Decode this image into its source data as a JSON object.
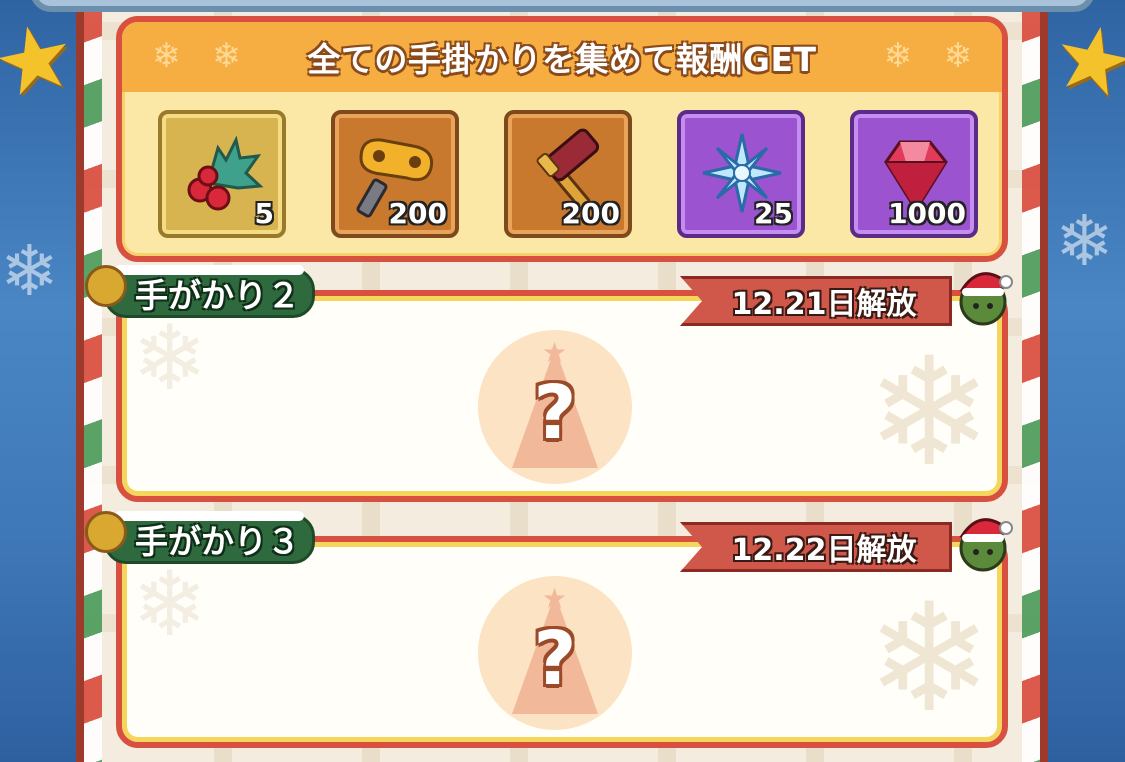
{
  "reward_panel": {
    "title": "全ての手掛かりを集めて報酬GET",
    "items": [
      {
        "icon": "holly-icon",
        "count": "5"
      },
      {
        "icon": "wind-up-key-icon",
        "count": "200"
      },
      {
        "icon": "hammer-icon",
        "count": "200"
      },
      {
        "icon": "snowflake-crystal-icon",
        "count": "25"
      },
      {
        "icon": "ruby-gem-icon",
        "count": "1000"
      }
    ]
  },
  "clues": [
    {
      "label": "手がかり２",
      "unlock": "12.21日解放",
      "locked_symbol": "?"
    },
    {
      "label": "手がかり３",
      "unlock": "12.22日解放",
      "locked_symbol": "?"
    }
  ],
  "colors": {
    "frame_red": "#d8503f",
    "header_orange": "#f6ae42",
    "card_yellow": "#fbe7a6",
    "tag_green": "#2e6a3e",
    "ribbon_red": "#d0584a"
  }
}
